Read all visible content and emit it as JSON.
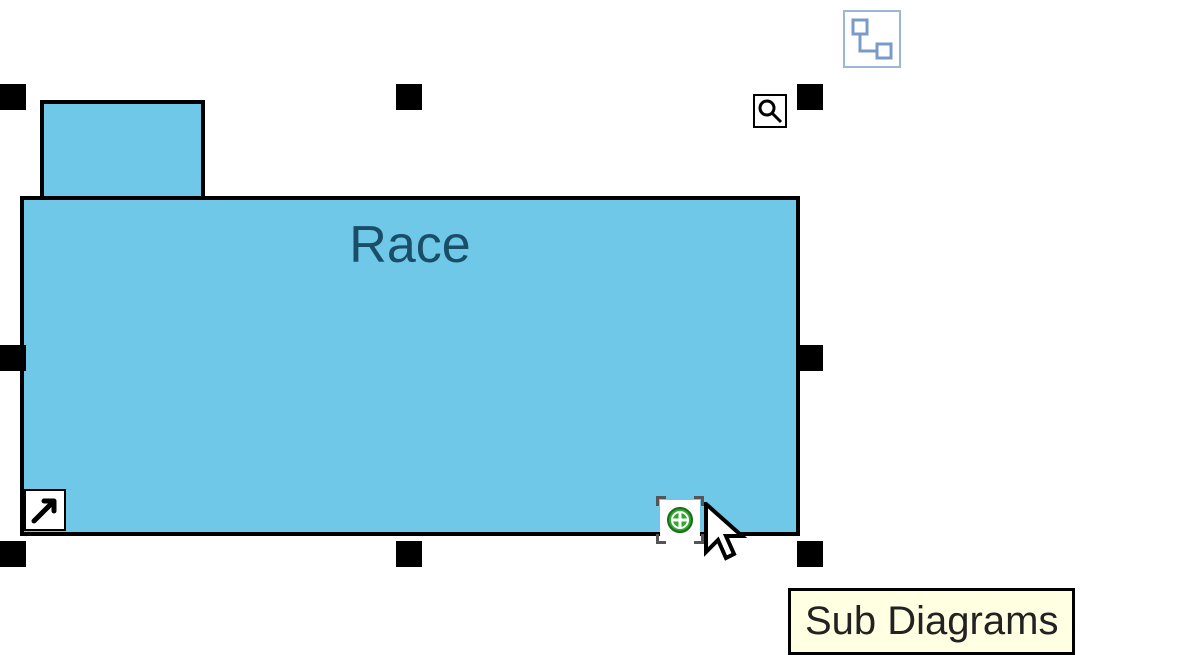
{
  "package": {
    "name": "Race"
  },
  "tooltip": {
    "text": "Sub Diagrams"
  },
  "icons": {
    "quicklink": "quick-link",
    "magnify": "magnify",
    "shortcut": "shortcut-arrow",
    "subdiagram": "sub-diagrams"
  }
}
